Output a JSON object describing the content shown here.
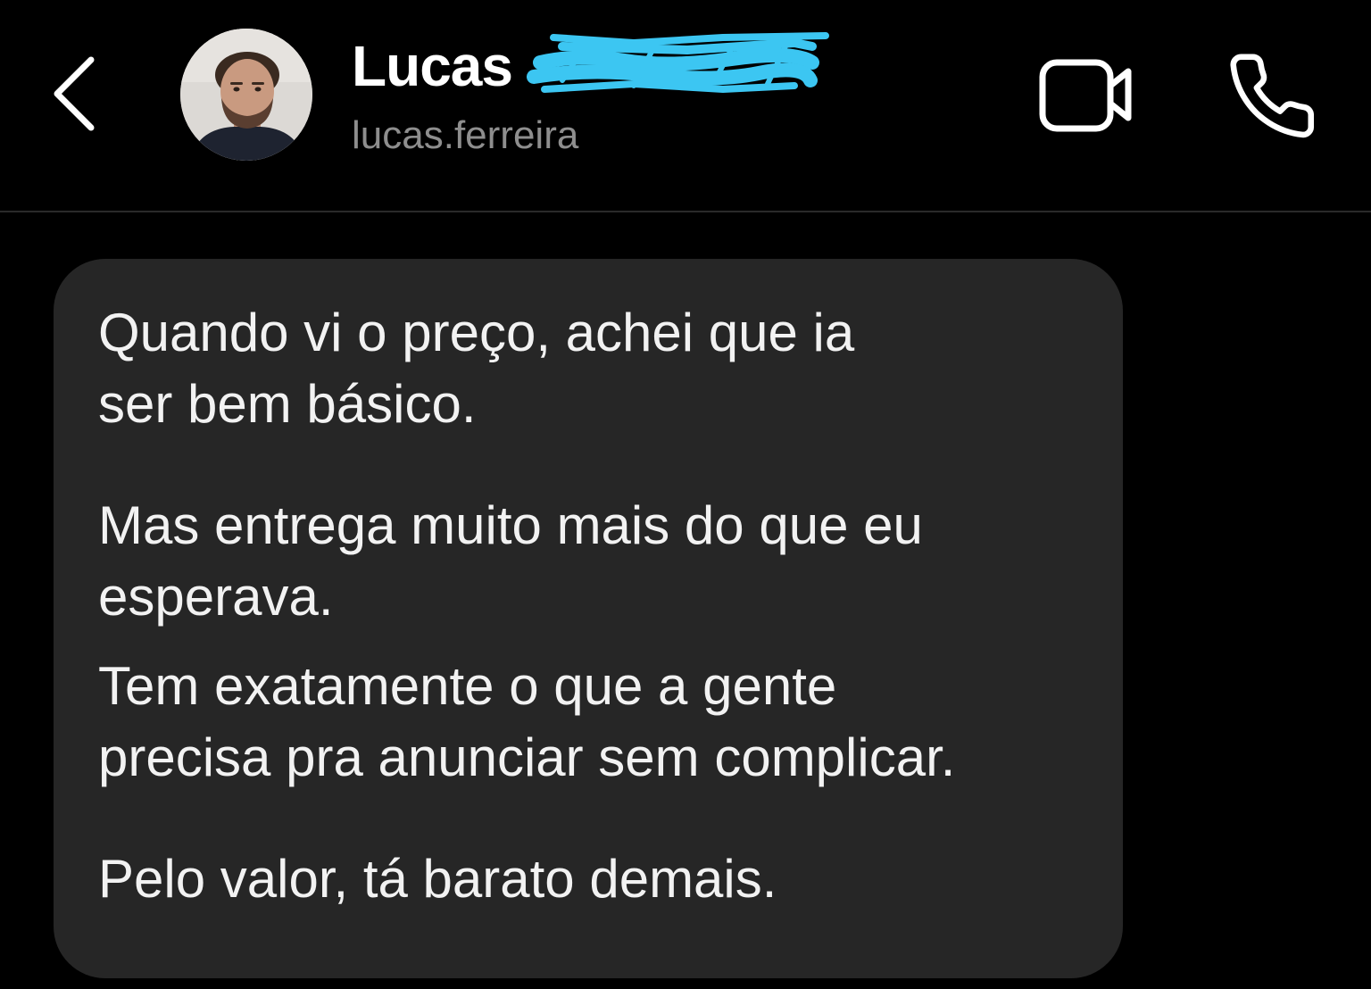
{
  "header": {
    "contact_name": "Lucas",
    "username": "lucas.ferreira",
    "icons": {
      "back": "chevron-left-icon",
      "video": "video-camera-icon",
      "call": "phone-icon"
    }
  },
  "message": {
    "paragraphs": [
      [
        "Quando vi o preço, achei que ia",
        "ser bem básico."
      ],
      [
        "Mas entrega muito mais do que eu",
        "esperava."
      ],
      [
        "Tem exatamente o que a gente",
        "precisa pra anunciar sem complicar."
      ],
      [
        "Pelo valor, tá barato demais."
      ]
    ]
  },
  "colors": {
    "background": "#000000",
    "bubble": "#262626",
    "text": "#f2f2f2",
    "secondary_text": "#8e8e8e",
    "redaction": "#3cc6f2"
  }
}
